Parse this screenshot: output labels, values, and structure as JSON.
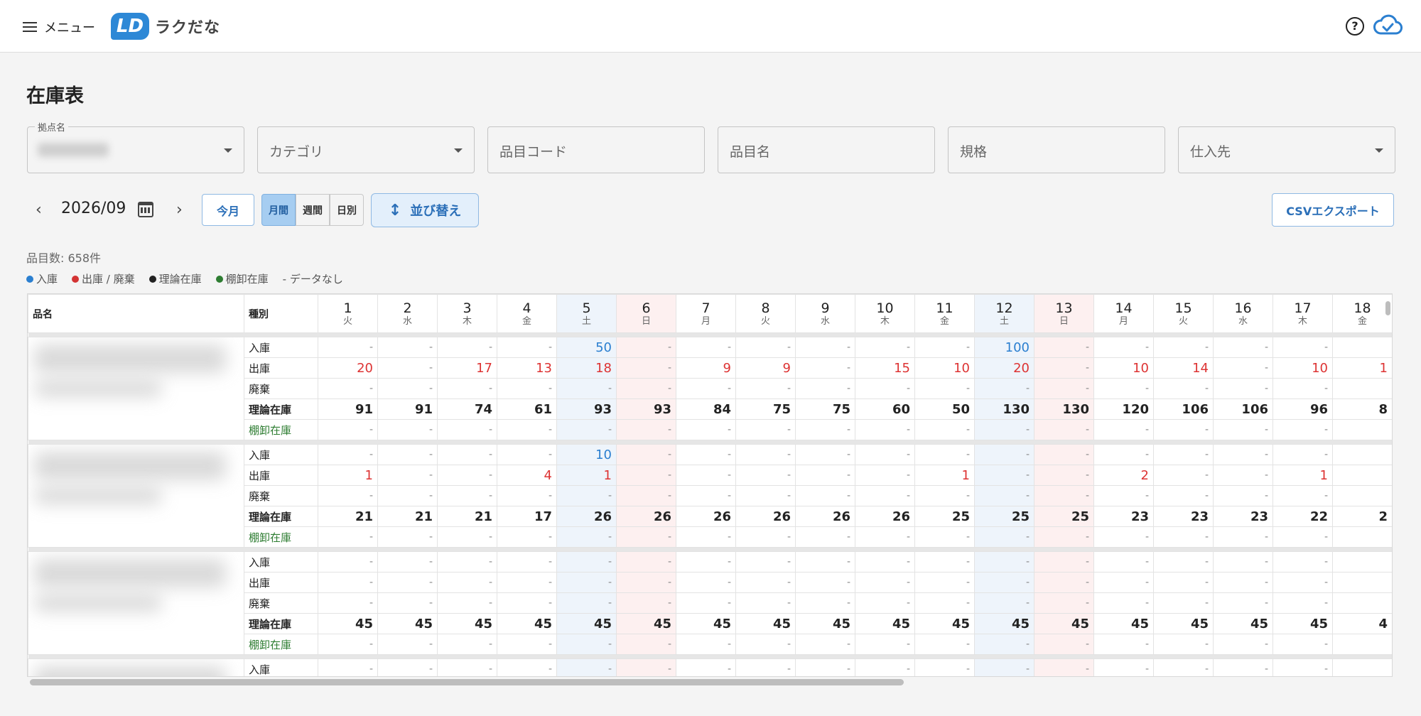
{
  "header": {
    "menu_label": "メニュー",
    "logo_text": "ラクだな",
    "logo_mark": "LD"
  },
  "page": {
    "title": "在庫表"
  },
  "filters": {
    "location_legend": "拠点名",
    "category_placeholder": "カテゴリ",
    "item_code_placeholder": "品目コード",
    "item_name_placeholder": "品目名",
    "spec_placeholder": "規格",
    "supplier_placeholder": "仕入先"
  },
  "toolbar": {
    "month": "2026/09",
    "this_month": "今月",
    "view_monthly": "月間",
    "view_weekly": "週間",
    "view_daily": "日別",
    "sort": "並び替え",
    "csv_export": "CSVエクスポート"
  },
  "item_count": "品目数: 658件",
  "legend": {
    "in": "入庫",
    "out": "出庫 / 廃棄",
    "theory": "理論在庫",
    "stocktake": "棚卸在庫",
    "none": "- データなし",
    "colors": {
      "in": "#2b7fd0",
      "out": "#d33333",
      "theory": "#222222",
      "stocktake": "#2e7d32"
    }
  },
  "table": {
    "header_name": "品名",
    "header_type": "種別",
    "days": [
      {
        "d": "1",
        "w": "火"
      },
      {
        "d": "2",
        "w": "水"
      },
      {
        "d": "3",
        "w": "木"
      },
      {
        "d": "4",
        "w": "金"
      },
      {
        "d": "5",
        "w": "土"
      },
      {
        "d": "6",
        "w": "日"
      },
      {
        "d": "7",
        "w": "月"
      },
      {
        "d": "8",
        "w": "火"
      },
      {
        "d": "9",
        "w": "水"
      },
      {
        "d": "10",
        "w": "木"
      },
      {
        "d": "11",
        "w": "金"
      },
      {
        "d": "12",
        "w": "土"
      },
      {
        "d": "13",
        "w": "日"
      },
      {
        "d": "14",
        "w": "月"
      },
      {
        "d": "15",
        "w": "火"
      },
      {
        "d": "16",
        "w": "水"
      },
      {
        "d": "17",
        "w": "木"
      },
      {
        "d": "18",
        "w": "金"
      }
    ],
    "groups": [
      {
        "rows": [
          {
            "type": "入庫",
            "kind": "in",
            "values": [
              "-",
              "-",
              "-",
              "-",
              "50",
              "-",
              "-",
              "-",
              "-",
              "-",
              "-",
              "100",
              "-",
              "-",
              "-",
              "-",
              "-",
              ""
            ]
          },
          {
            "type": "出庫",
            "kind": "out",
            "values": [
              "20",
              "-",
              "17",
              "13",
              "18",
              "-",
              "9",
              "9",
              "-",
              "15",
              "10",
              "20",
              "-",
              "10",
              "14",
              "-",
              "10",
              "1"
            ]
          },
          {
            "type": "廃棄",
            "kind": "out",
            "values": [
              "-",
              "-",
              "-",
              "-",
              "-",
              "-",
              "-",
              "-",
              "-",
              "-",
              "-",
              "-",
              "-",
              "-",
              "-",
              "-",
              "-",
              ""
            ]
          },
          {
            "type": "理論在庫",
            "kind": "theory",
            "values": [
              "91",
              "91",
              "74",
              "61",
              "93",
              "93",
              "84",
              "75",
              "75",
              "60",
              "50",
              "130",
              "130",
              "120",
              "106",
              "106",
              "96",
              "8"
            ]
          },
          {
            "type": "棚卸在庫",
            "kind": "stocktake",
            "values": [
              "-",
              "-",
              "-",
              "-",
              "-",
              "-",
              "-",
              "-",
              "-",
              "-",
              "-",
              "-",
              "-",
              "-",
              "-",
              "-",
              "-",
              ""
            ]
          }
        ]
      },
      {
        "rows": [
          {
            "type": "入庫",
            "kind": "in",
            "values": [
              "-",
              "-",
              "-",
              "-",
              "10",
              "-",
              "-",
              "-",
              "-",
              "-",
              "-",
              "-",
              "-",
              "-",
              "-",
              "-",
              "-",
              ""
            ]
          },
          {
            "type": "出庫",
            "kind": "out",
            "values": [
              "1",
              "-",
              "-",
              "4",
              "1",
              "-",
              "-",
              "-",
              "-",
              "-",
              "1",
              "-",
              "-",
              "2",
              "-",
              "-",
              "1",
              ""
            ]
          },
          {
            "type": "廃棄",
            "kind": "out",
            "values": [
              "-",
              "-",
              "-",
              "-",
              "-",
              "-",
              "-",
              "-",
              "-",
              "-",
              "-",
              "-",
              "-",
              "-",
              "-",
              "-",
              "-",
              ""
            ]
          },
          {
            "type": "理論在庫",
            "kind": "theory",
            "values": [
              "21",
              "21",
              "21",
              "17",
              "26",
              "26",
              "26",
              "26",
              "26",
              "26",
              "25",
              "25",
              "25",
              "23",
              "23",
              "23",
              "22",
              "2"
            ]
          },
          {
            "type": "棚卸在庫",
            "kind": "stocktake",
            "values": [
              "-",
              "-",
              "-",
              "-",
              "-",
              "-",
              "-",
              "-",
              "-",
              "-",
              "-",
              "-",
              "-",
              "-",
              "-",
              "-",
              "-",
              ""
            ]
          }
        ]
      },
      {
        "rows": [
          {
            "type": "入庫",
            "kind": "in",
            "values": [
              "-",
              "-",
              "-",
              "-",
              "-",
              "-",
              "-",
              "-",
              "-",
              "-",
              "-",
              "-",
              "-",
              "-",
              "-",
              "-",
              "-",
              ""
            ]
          },
          {
            "type": "出庫",
            "kind": "out",
            "values": [
              "-",
              "-",
              "-",
              "-",
              "-",
              "-",
              "-",
              "-",
              "-",
              "-",
              "-",
              "-",
              "-",
              "-",
              "-",
              "-",
              "-",
              ""
            ]
          },
          {
            "type": "廃棄",
            "kind": "out",
            "values": [
              "-",
              "-",
              "-",
              "-",
              "-",
              "-",
              "-",
              "-",
              "-",
              "-",
              "-",
              "-",
              "-",
              "-",
              "-",
              "-",
              "-",
              ""
            ]
          },
          {
            "type": "理論在庫",
            "kind": "theory",
            "values": [
              "45",
              "45",
              "45",
              "45",
              "45",
              "45",
              "45",
              "45",
              "45",
              "45",
              "45",
              "45",
              "45",
              "45",
              "45",
              "45",
              "45",
              "4"
            ]
          },
          {
            "type": "棚卸在庫",
            "kind": "stocktake",
            "values": [
              "-",
              "-",
              "-",
              "-",
              "-",
              "-",
              "-",
              "-",
              "-",
              "-",
              "-",
              "-",
              "-",
              "-",
              "-",
              "-",
              "-",
              ""
            ]
          }
        ]
      },
      {
        "rows": [
          {
            "type": "入庫",
            "kind": "in",
            "values": [
              "-",
              "-",
              "-",
              "-",
              "-",
              "-",
              "-",
              "-",
              "-",
              "-",
              "-",
              "-",
              "-",
              "-",
              "-",
              "-",
              "-",
              ""
            ]
          }
        ]
      }
    ]
  }
}
